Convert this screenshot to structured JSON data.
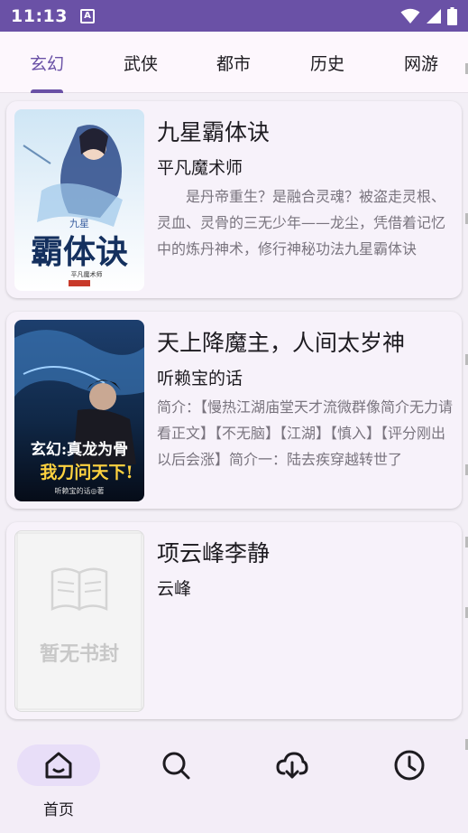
{
  "status_bar": {
    "time": "11:13",
    "notification_icon": "A"
  },
  "tabs": [
    {
      "label": "玄幻",
      "active": true
    },
    {
      "label": "武侠",
      "active": false
    },
    {
      "label": "都市",
      "active": false
    },
    {
      "label": "历史",
      "active": false
    },
    {
      "label": "网游",
      "active": false
    }
  ],
  "books": [
    {
      "title": "九星霸体诀",
      "author": "平凡魔术师",
      "description": "　　是丹帝重生？是融合灵魂？被盗走灵根、灵血、灵骨的三无少年——龙尘，凭借着记忆中的炼丹神术，修行神秘功法九星霸体诀",
      "cover": {
        "small_title": "九星",
        "main_title": "霸体诀",
        "author": "平凡魔术师"
      }
    },
    {
      "title": "天上降魔主，人间太岁神",
      "author": "听赖宝的话",
      "description": "简介：【慢热江湖庙堂天才流微群像简介无力请看正文】【不无脑】【江湖】【慎入】【评分刚出以后会涨】简介一：陆去疾穿越转世了",
      "cover": {
        "line1": "玄幻:真龙为骨",
        "line2": "我刀问天下!",
        "author": "听赖宝的话◎著"
      }
    },
    {
      "title": "项云峰李静",
      "author": "云峰",
      "description": "",
      "cover": {
        "placeholder": "暂无书封"
      }
    }
  ],
  "bottom_nav": [
    {
      "label": "首页",
      "icon": "home-icon",
      "active": true
    },
    {
      "label": "",
      "icon": "search-icon",
      "active": false
    },
    {
      "label": "",
      "icon": "cloud-download-icon",
      "active": false
    },
    {
      "label": "",
      "icon": "history-clock-icon",
      "active": false
    }
  ],
  "colors": {
    "primary": "#6a51a6",
    "surface": "#f7f2fa",
    "indicator_bg": "#e8def8"
  }
}
